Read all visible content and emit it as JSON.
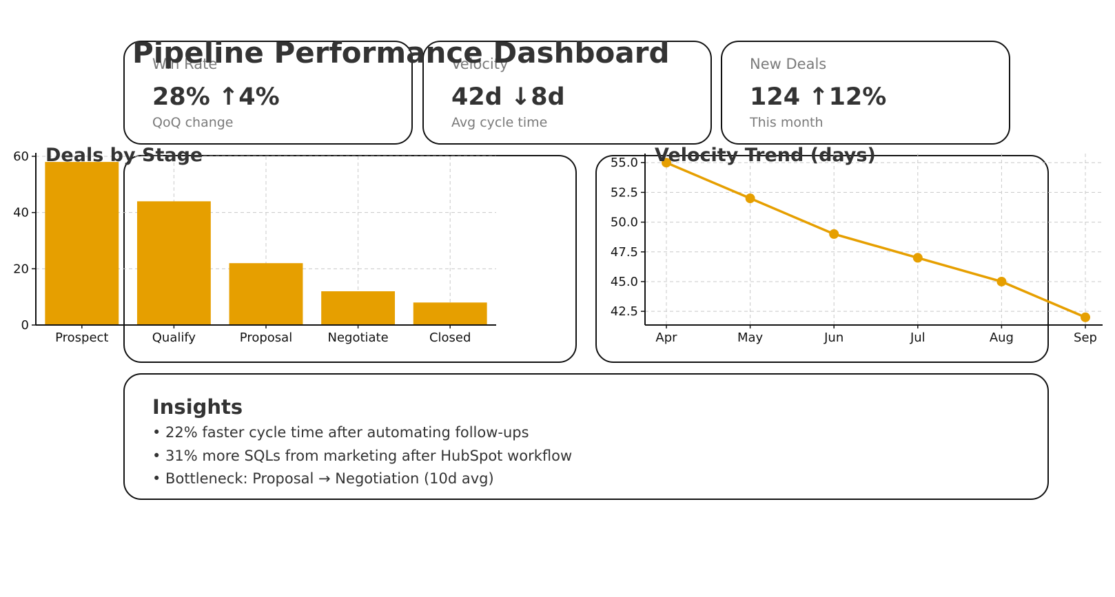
{
  "dashboard": {
    "title": "Pipeline Performance Dashboard"
  },
  "kpis": [
    {
      "label": "Win Rate",
      "value": "28% ↑4%",
      "sub": "QoQ change"
    },
    {
      "label": "Velocity",
      "value": "42d ↓8d",
      "sub": "Avg cycle time"
    },
    {
      "label": "New Deals",
      "value": "124 ↑12%",
      "sub": "This month"
    }
  ],
  "insights": {
    "title": "Insights",
    "items": [
      "• 22% faster cycle time after automating follow-ups",
      "• 31% more SQLs from marketing after HubSpot workflow",
      "• Bottleneck: Proposal → Negotiation (10d avg)"
    ]
  },
  "colors": {
    "accent": "#E69F00",
    "text": "#333333",
    "muted": "#7a7a7a",
    "grid": "#c8c8c8"
  },
  "chart_data": [
    {
      "type": "bar",
      "title": "Deals by Stage",
      "categories": [
        "Prospect",
        "Qualify",
        "Proposal",
        "Negotiate",
        "Closed"
      ],
      "values": [
        58,
        44,
        22,
        12,
        8
      ],
      "ylim": [
        0,
        60
      ],
      "yticks": [
        0,
        20,
        40,
        60
      ],
      "grid": true
    },
    {
      "type": "line",
      "title": "Velocity Trend (days)",
      "categories": [
        "Apr",
        "May",
        "Jun",
        "Jul",
        "Aug",
        "Sep"
      ],
      "values": [
        55,
        52,
        49,
        47,
        45,
        42
      ],
      "ylim": [
        41.35,
        55.65
      ],
      "yticks": [
        42.5,
        45.0,
        47.5,
        50.0,
        52.5,
        55.0
      ],
      "grid": true
    }
  ]
}
